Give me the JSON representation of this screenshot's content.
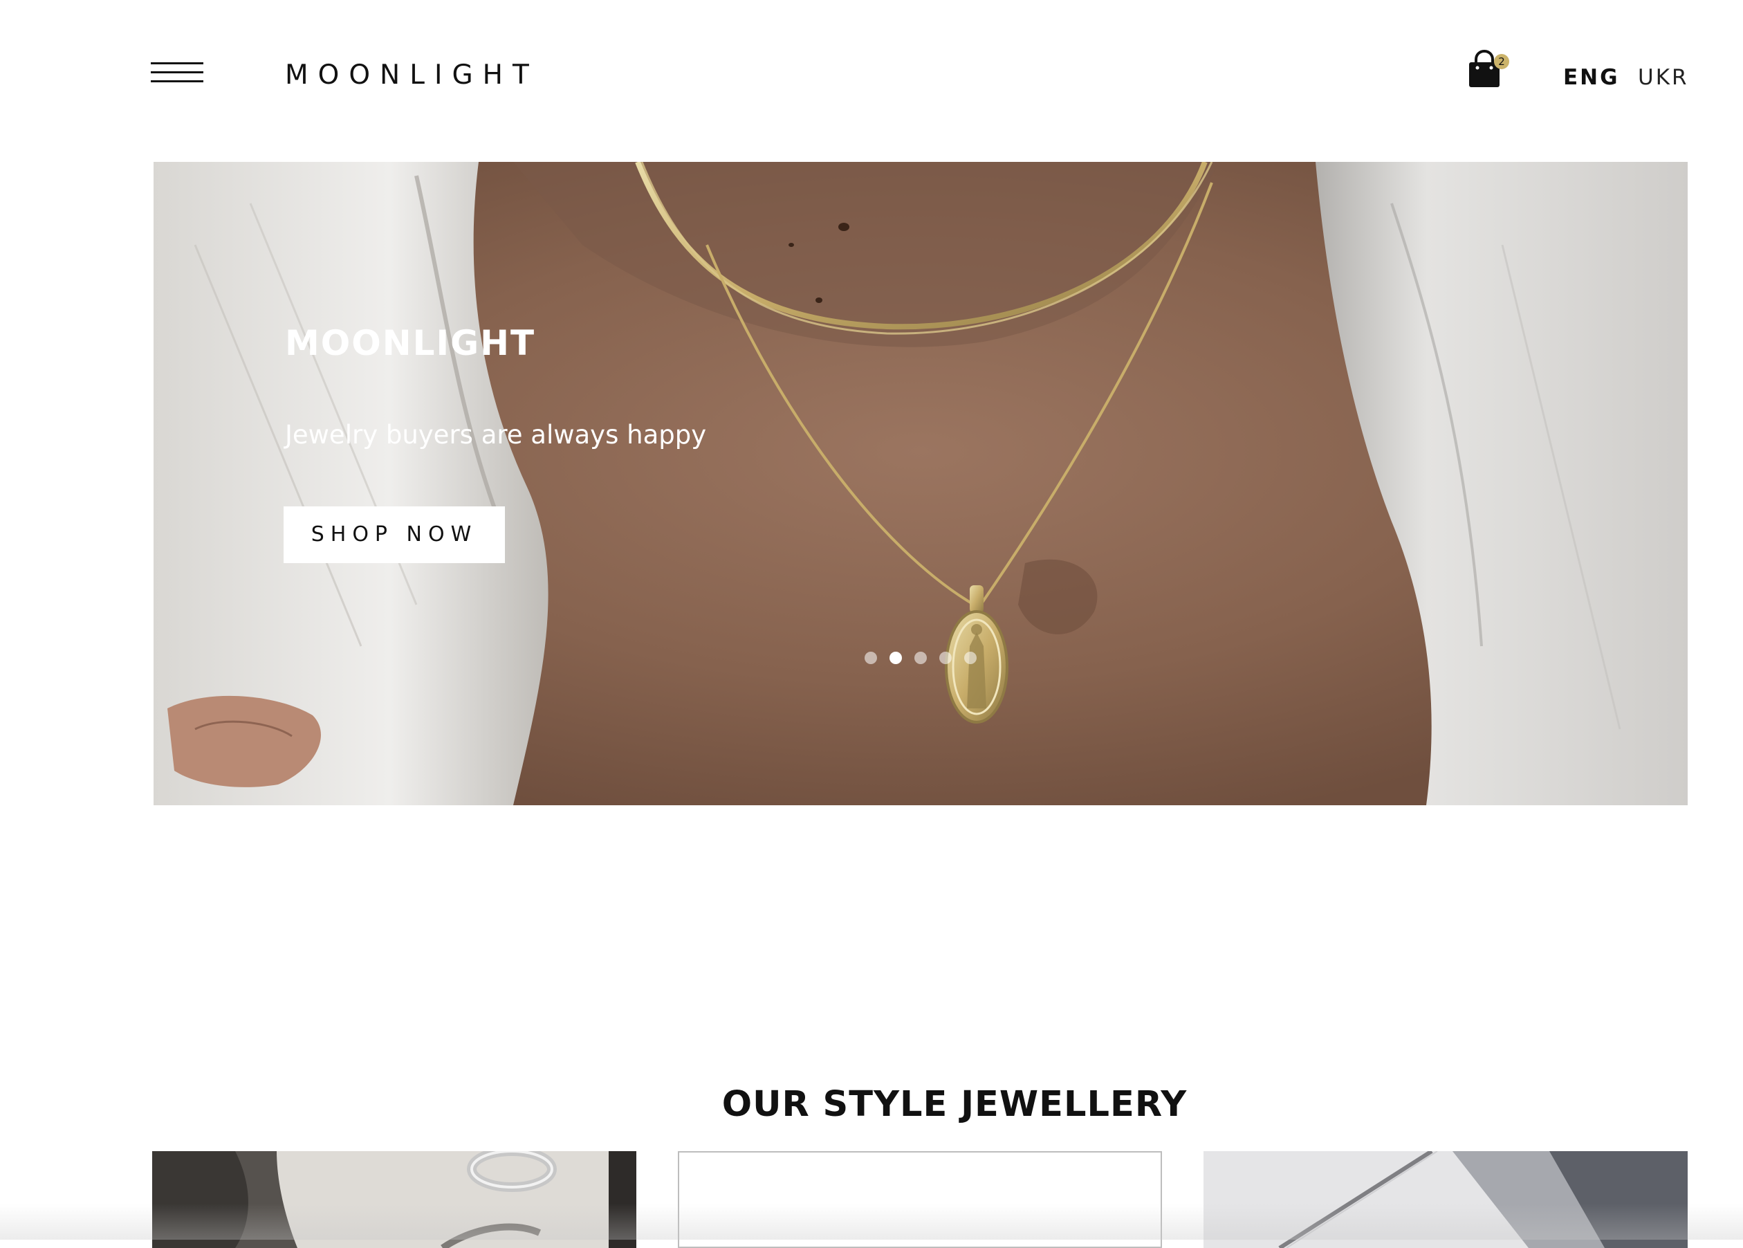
{
  "header": {
    "brand": "MOONLIGHT",
    "cart": {
      "count": "2"
    },
    "languages": [
      {
        "label": "ENG",
        "active": true
      },
      {
        "label": "UKR",
        "active": false
      }
    ]
  },
  "hero": {
    "title": "MOONLIGHT",
    "subtitle": "Jewelry buyers are always happy",
    "button_label": "SHOP NOW",
    "slides_total": 5,
    "active_slide": 2
  },
  "section": {
    "title": "OUR STYLE JEWELLERY"
  },
  "colors": {
    "text": "#111111",
    "badge": "#cbb36a",
    "hero_overlay_text": "#ffffff"
  },
  "icons": {
    "menu": "hamburger-menu-icon",
    "cart": "shopping-bag-icon"
  }
}
